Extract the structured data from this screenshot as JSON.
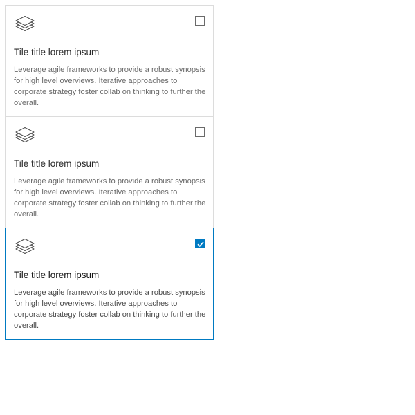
{
  "colors": {
    "accent": "#007ac2",
    "border": "#dcdcdc",
    "title_text": "#2b2b2b",
    "description_text": "#6a6a6a"
  },
  "tiles": [
    {
      "icon": "layers-icon",
      "title": "Tile title lorem ipsum",
      "description": "Leverage agile frameworks to provide a robust synopsis for high level overviews. Iterative approaches to corporate strategy foster collab on thinking to further the overall.",
      "checked": false
    },
    {
      "icon": "layers-icon",
      "title": "Tile title lorem ipsum",
      "description": "Leverage agile frameworks to provide a robust synopsis for high level overviews. Iterative approaches to corporate strategy foster collab on thinking to further the overall.",
      "checked": false
    },
    {
      "icon": "layers-icon",
      "title": "Tile title lorem ipsum",
      "description": "Leverage agile frameworks to provide a robust synopsis for high level overviews. Iterative approaches to corporate strategy foster collab on thinking to further the overall.",
      "checked": true
    }
  ]
}
